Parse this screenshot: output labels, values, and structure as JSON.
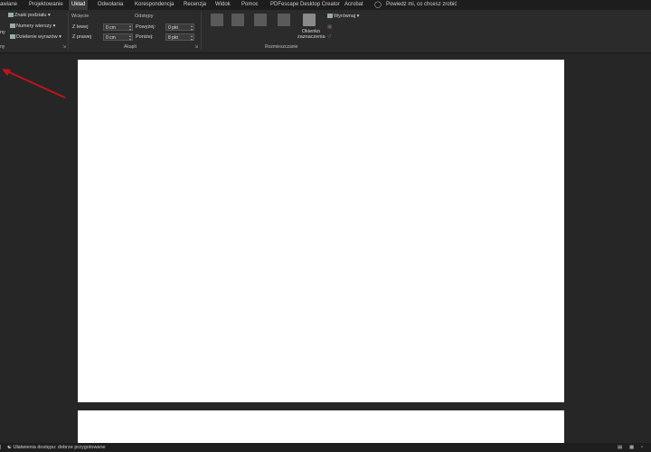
{
  "tabs": [
    "awiane",
    "Projektowanie",
    "Układ",
    "Odwołania",
    "Korespondencja",
    "Recenzja",
    "Widok",
    "Pomoc",
    "PDFescape Desktop Creator",
    "Acrobat"
  ],
  "active_tab": "Układ",
  "search_placeholder": "Powiedz mi, co chcesz zrobić",
  "ribbon": {
    "page_setup": {
      "left_cut_label": "ny",
      "breaks": "Znaki podziału",
      "line_numbers": "Numery wierszy",
      "hyphenation": "Dzielenie wyrazów",
      "title": "ny"
    },
    "paragraph": {
      "indent_title": "Wcięcie",
      "indent_left_label": "Z lewej",
      "indent_left_value": "0 cm",
      "indent_right_label": "Z prawej",
      "indent_right_value": "0 cm",
      "spacing_title": "Odstępy",
      "spacing_before_label": "Powyżej:",
      "spacing_before_value": "0 pkt",
      "spacing_after_label": "Poniżej:",
      "spacing_after_value": "8 pkt",
      "title": "Akapit"
    },
    "arrange": {
      "selection_pane": "Okienko zaznaczenia",
      "align": "Wyrównaj",
      "title": "Rozmieszczanie"
    }
  },
  "status": {
    "accessibility": "Ułatwienia dostępu: dobrze przygotowane"
  },
  "colors": {
    "background": "#262626",
    "ribbon": "#2b2b2b",
    "tabbar": "#1d1d1d",
    "arrow": "#c0141c"
  }
}
